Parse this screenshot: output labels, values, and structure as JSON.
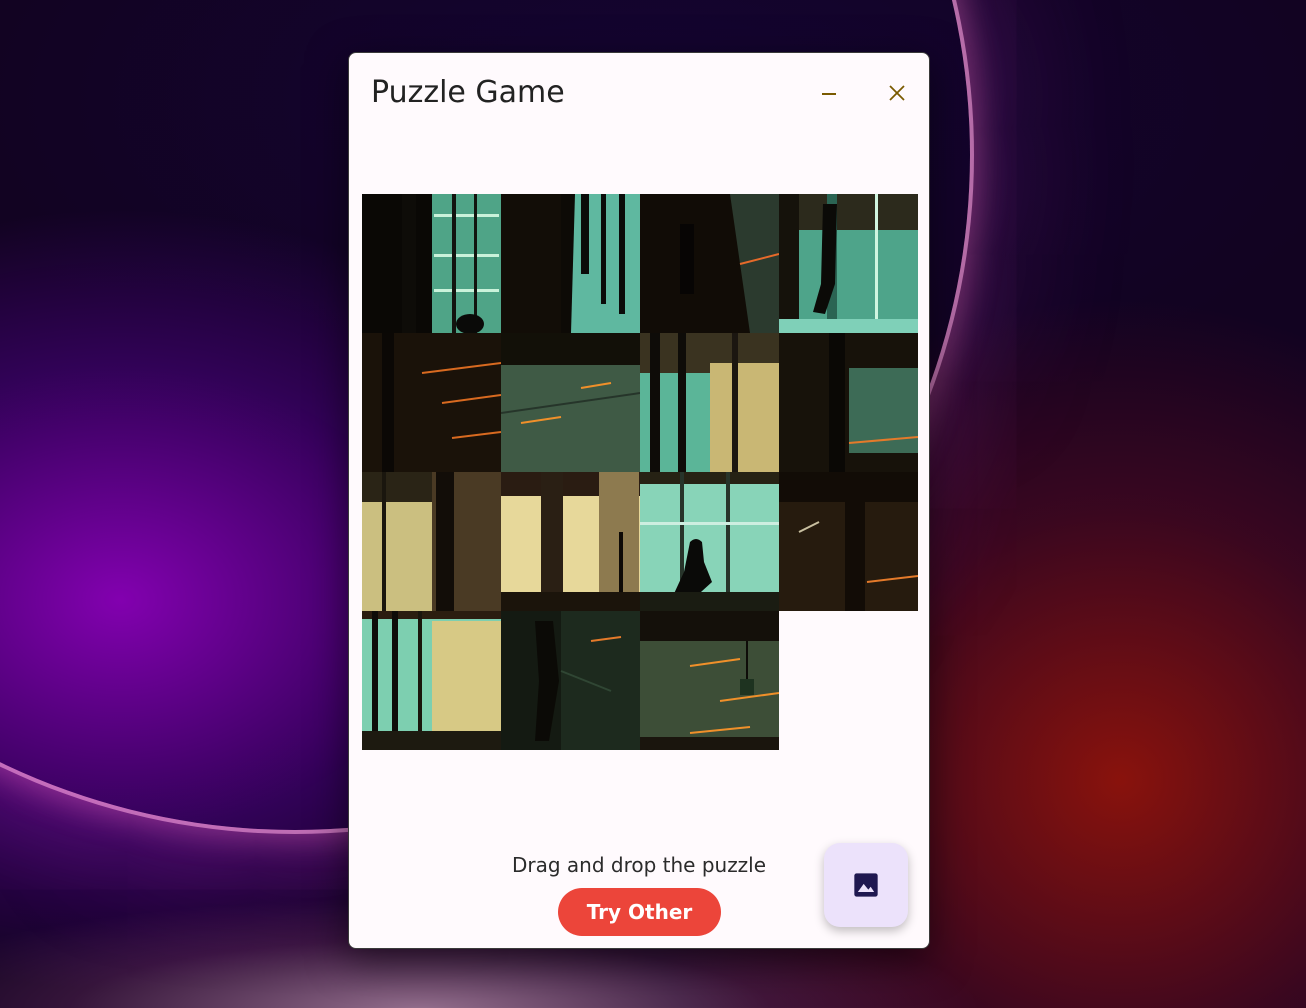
{
  "window": {
    "title": "Puzzle Game"
  },
  "title_bar": {
    "minimize_icon": "minimize-icon",
    "close_icon": "close-icon"
  },
  "puzzle": {
    "rows": 4,
    "columns": 4,
    "empty_slot": {
      "row": 3,
      "col": 3
    }
  },
  "instruction": "Drag and drop the puzzle",
  "buttons": {
    "try_other": "Try Other",
    "image_picker_icon": "image-icon"
  },
  "colors": {
    "accent_button": "#ec453a",
    "fab_background": "#ece2fb",
    "title_bar_icons": "#7a5a00",
    "fab_icon": "#1f1850"
  }
}
